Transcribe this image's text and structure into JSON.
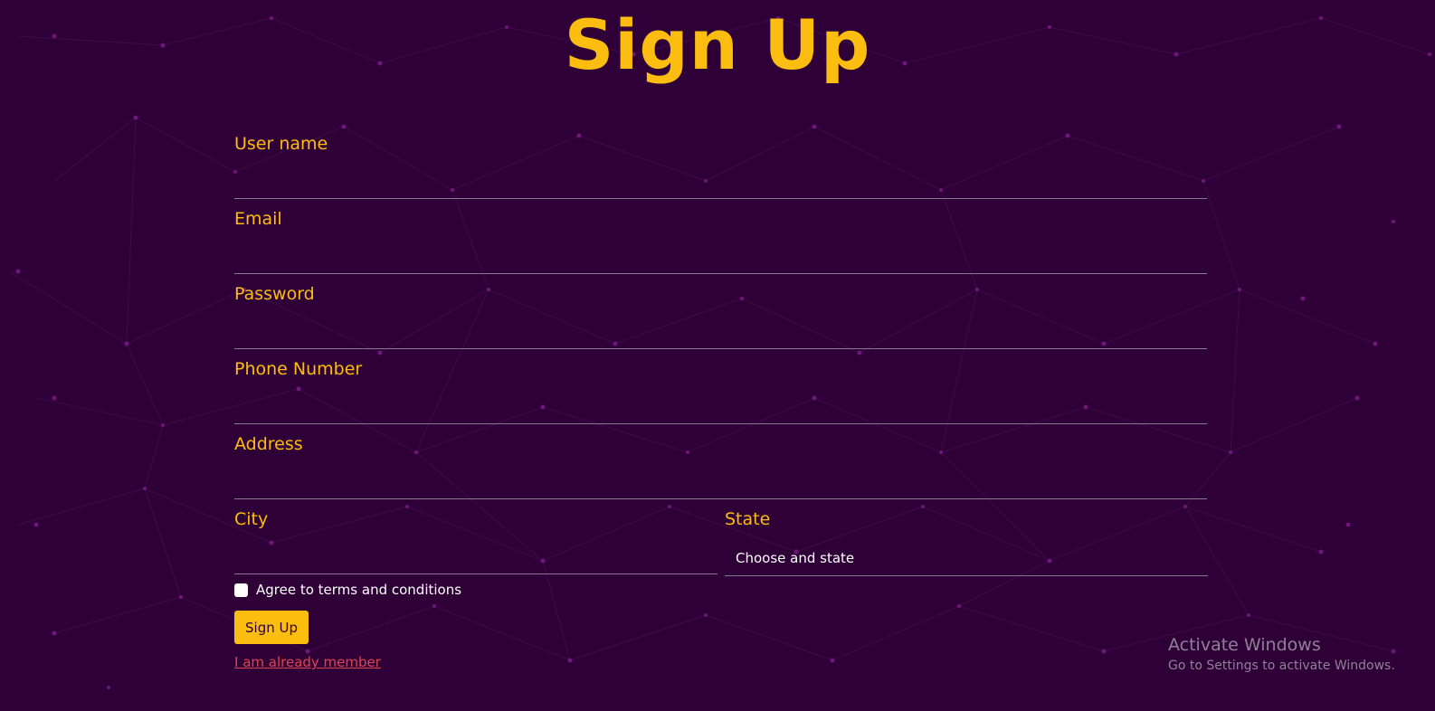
{
  "page": {
    "title": "Sign Up"
  },
  "form": {
    "fields": [
      {
        "label": "User name",
        "value": ""
      },
      {
        "label": "Email",
        "value": ""
      },
      {
        "label": "Password",
        "value": ""
      },
      {
        "label": "Phone Number",
        "value": ""
      },
      {
        "label": "Address",
        "value": ""
      },
      {
        "label": "City",
        "value": ""
      }
    ],
    "state": {
      "label": "State",
      "selected": "Choose and state"
    },
    "agree_text": "Agree to terms and conditions",
    "agree_checked": false,
    "submit_label": "Sign Up",
    "member_link": "I am already member"
  },
  "watermark": {
    "title": "Activate Windows",
    "subtitle": "Go to Settings to activate Windows."
  },
  "colors": {
    "background": "#2f0037",
    "accent": "#fbbd0f",
    "link": "#e0454f",
    "text": "#ffffff"
  }
}
